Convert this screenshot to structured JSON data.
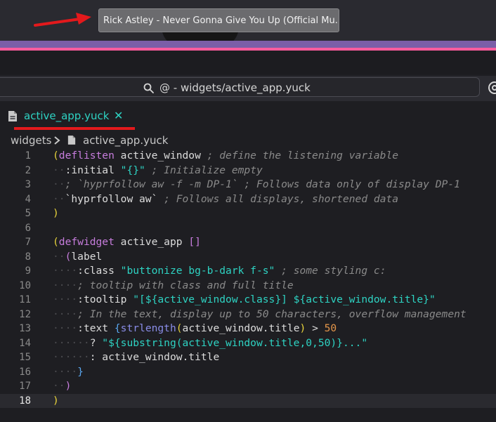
{
  "video_tooltip": {
    "text": "Rick Astley - Never Gonna Give You Up (Official Mu..."
  },
  "colors": {
    "accent_teal": "#2ed3c3",
    "annotation_red": "#e3191c",
    "strip_pink": "#ff5c9d"
  },
  "title_bar": {
    "search_text": "@ - widgets/active_app.yuck",
    "search_icon": "search-icon"
  },
  "tab": {
    "label": "active_app.yuck",
    "close_glyph": "✕",
    "icon": "file-icon"
  },
  "breadcrumb": {
    "folder": "widgets",
    "file": "active_app.yuck"
  },
  "editor": {
    "current_line": 18,
    "line_numbers": [
      "1",
      "2",
      "3",
      "4",
      "5",
      "6",
      "7",
      "8",
      "9",
      "10",
      "11",
      "12",
      "13",
      "14",
      "15",
      "16",
      "17",
      "18"
    ]
  }
}
